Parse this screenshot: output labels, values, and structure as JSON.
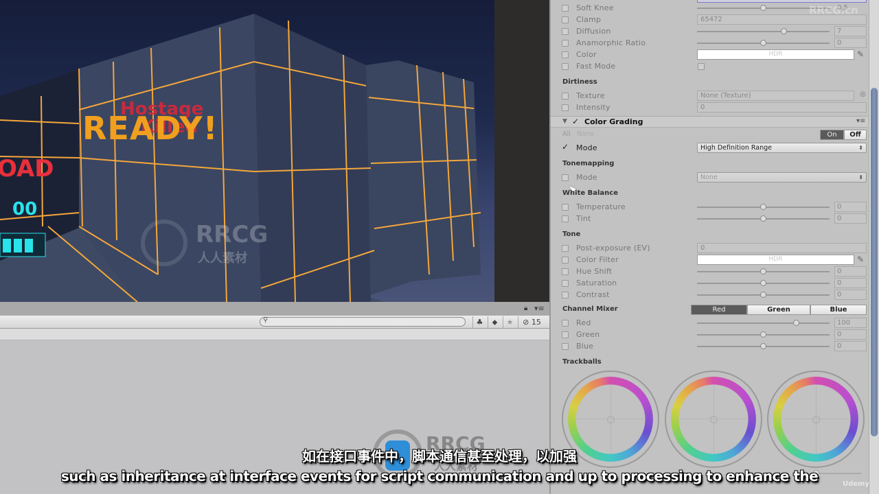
{
  "game_view": {
    "hud_ready": "READY!",
    "hud_hostage": "Hostage",
    "hud_killed": "Killed",
    "hud_reload": "OAD",
    "hud_ammo": "00",
    "colors": {
      "ready": "#f0a01e",
      "reload": "#e8303c",
      "ammo": "#29e3ea",
      "grid_line": "#f5a73a"
    }
  },
  "hierarchy": {
    "search_placeholder": "",
    "hidden_count": "15"
  },
  "inspector": {
    "bloom_rows": [
      {
        "label": "Soft Knee",
        "type": "slider",
        "value": "0.5",
        "fraction": 0.5
      },
      {
        "label": "Clamp",
        "type": "field",
        "value": "65472"
      },
      {
        "label": "Diffusion",
        "type": "slider",
        "value": "7",
        "fraction": 0.66
      },
      {
        "label": "Anamorphic Ratio",
        "type": "slider",
        "value": "0",
        "fraction": 0.5
      },
      {
        "label": "Color",
        "type": "color",
        "value": "HDR"
      },
      {
        "label": "Fast Mode",
        "type": "checkbox",
        "value": ""
      }
    ],
    "dirtiness": {
      "title": "Dirtiness",
      "rows": [
        {
          "label": "Texture",
          "type": "object",
          "value": "None (Texture)"
        },
        {
          "label": "Intensity",
          "type": "field",
          "value": "0"
        }
      ]
    },
    "color_grading": {
      "title": "Color Grading",
      "all_label": "All",
      "none_label": "None",
      "on_label": "On",
      "off_label": "Off",
      "mode_label": "Mode",
      "mode_value": "High Definition Range"
    },
    "tonemapping": {
      "title": "Tonemapping",
      "mode_label": "Mode",
      "mode_value": "None"
    },
    "white_balance": {
      "title": "White Balance",
      "rows": [
        {
          "label": "Temperature",
          "value": "0",
          "fraction": 0.5
        },
        {
          "label": "Tint",
          "value": "0",
          "fraction": 0.5
        }
      ]
    },
    "tone": {
      "title": "Tone",
      "post_exposure_label": "Post-exposure (EV)",
      "post_exposure_value": "0",
      "color_filter_label": "Color Filter",
      "color_filter_value": "HDR",
      "rows": [
        {
          "label": "Hue Shift",
          "value": "0",
          "fraction": 0.5
        },
        {
          "label": "Saturation",
          "value": "0",
          "fraction": 0.5
        },
        {
          "label": "Contrast",
          "value": "0",
          "fraction": 0.5
        }
      ]
    },
    "channel_mixer": {
      "title": "Channel Mixer",
      "tabs": [
        "Red",
        "Green",
        "Blue"
      ],
      "active_tab": "Red",
      "rows": [
        {
          "label": "Red",
          "value": "100",
          "fraction": 0.75
        },
        {
          "label": "Green",
          "value": "0",
          "fraction": 0.5
        },
        {
          "label": "Blue",
          "value": "0",
          "fraction": 0.5
        }
      ]
    },
    "trackballs": {
      "title": "Trackballs",
      "count": 3
    }
  },
  "subtitles": {
    "chinese": "如在接口事件中，脚本通信甚至处理，以加强",
    "english": "such as inheritance at interface events for script communication and up to processing to enhance the"
  },
  "watermarks": {
    "top_right": "RRCG.cn",
    "center_brand": "RRCG",
    "center_cn": "人人素材",
    "udemy": "Udemy"
  }
}
